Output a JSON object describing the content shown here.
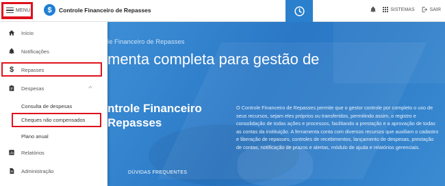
{
  "header": {
    "menu_label": "MENU",
    "app_title": "Controle Financeiro de Repasses",
    "logo_glyph": "$",
    "systems_label": "SISTEMAS",
    "exit_label": "SAIR"
  },
  "sidebar": {
    "items": [
      {
        "label": "Início",
        "icon": "home-icon"
      },
      {
        "label": "Notificações",
        "icon": "bell-icon"
      },
      {
        "label": "Repasses",
        "icon": "dollar-icon"
      },
      {
        "label": "Despesas",
        "icon": "clipboard-icon"
      }
    ],
    "despesas_sub": [
      "Consulta de despesas",
      "Cheques não compensados",
      "Plano anual"
    ],
    "lower_items": [
      {
        "label": "Relatórios",
        "icon": "chart-icon"
      },
      {
        "label": "Administração",
        "icon": "document-icon"
      }
    ]
  },
  "hero": {
    "kicker": "le Financeiro de Repasses",
    "headline": "menta completa para gestão de",
    "subheadline_line1": "ntrole Financeiro",
    "subheadline_line2": "Repasses",
    "description": "O Controle Financeiro de Repasses permite que o gestor controle por completo o uso de seus recursos, sejam eles próprios ou transferidos, permitindo assim, o registro e consolidação de todas ações e processos, facilitando a prestação e a aprovação de todas as contas da instituição. A ferramenta conta com diversos recursos que auxiliam o cadastro e liberação de repasses, controles de recebimentos, lançamento de despesas, prestação de contas, notificação de prazos e alertas, módulo de ajuda e relatórios gerenciais.",
    "faq_label": "DÚVIDAS FREQUENTES"
  },
  "colors": {
    "accent": "#2a80cc",
    "highlight": "#e0101a",
    "hero_blue": "#2a78c6"
  }
}
